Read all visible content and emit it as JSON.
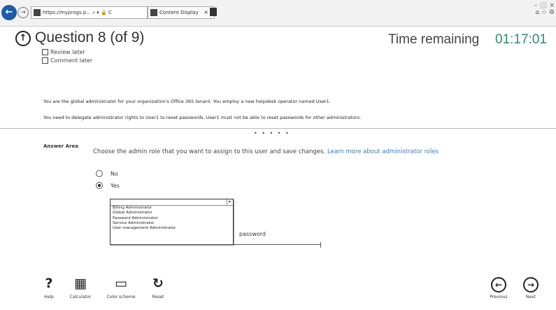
{
  "browser": {
    "address": "https://myprogs.p... ⌕ ▾ 🔒 C",
    "tab_title": "Content Display",
    "tab_close": "×",
    "window_controls": "– ⬜ ×"
  },
  "header": {
    "question_title": "Question 8 (of 9)",
    "time_label": "Time remaining",
    "time_value": "01:17:01",
    "review_later": "Review later",
    "comment_later": "Comment later"
  },
  "statement": {
    "line1": "You are the global administrator for your organization's Office 365 tenant. You employ a new helpdesk operator named User1.",
    "line2": "You need to delegate administrator rights to User1 to reset passwords. User1 must not be able to reset passwords for other administrators."
  },
  "dots": "• • • • •",
  "answer": {
    "label": "Answer Area",
    "instruction": "Choose the admin role that you want to assign to this user and save changes.",
    "learn_more": "Learn more about administrator roles",
    "radio_no": "No",
    "radio_yes": "Yes",
    "selected": "Yes",
    "dropdown_options": [
      "Billing Administrator",
      "Global Administrator",
      "Password Administrator",
      "Service Administrator",
      "User management Administrator"
    ],
    "password_word": "password"
  },
  "toolbar": {
    "help": "Help",
    "calculator": "Calculator",
    "color_scheme": "Color scheme",
    "reset": "Reset",
    "previous": "Previous",
    "next": "Next"
  },
  "icons": {
    "help": "question-mark-icon",
    "calculator": "calculator-icon",
    "color_scheme": "monitor-icon",
    "reset": "reset-icon",
    "previous": "arrow-left-icon",
    "next": "arrow-right-icon"
  },
  "colors": {
    "timer": "#2e8b72",
    "link": "#3d7bb8",
    "browser_back": "#1e5ba8"
  }
}
